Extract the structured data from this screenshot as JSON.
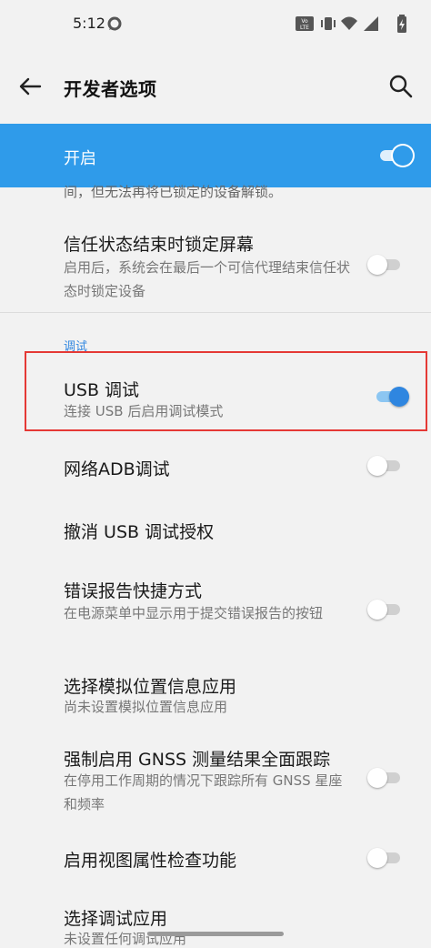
{
  "status_bar": {
    "time": "5:12",
    "volte_badge": "Vo LTE",
    "icons": [
      "whatsapp-icon",
      "volte-icon",
      "vibrate-icon",
      "wifi-icon",
      "signal-icon",
      "battery-charging-icon"
    ]
  },
  "app_bar": {
    "title": "开发者选项",
    "back_icon": "back-arrow-icon",
    "search_icon": "search-icon"
  },
  "master_switch": {
    "label": "开启",
    "on": true,
    "accent_color": "#2f9bea"
  },
  "truncated_text": "间，但无法再将已锁定的设备解锁。",
  "items": [
    {
      "id": "trust-agent-lock",
      "title": "信任状态结束时锁定屏幕",
      "subtitle": "启用后，系统会在最后一个可信代理结束信任状态时锁定设备",
      "toggle": false
    }
  ],
  "section": {
    "header": "调试"
  },
  "debug_items": [
    {
      "id": "usb-debugging",
      "title": "USB 调试",
      "subtitle": "连接 USB 后启用调试模式",
      "toggle": true,
      "highlighted": true
    },
    {
      "id": "network-adb",
      "title": "网络ADB调试",
      "subtitle": "",
      "toggle": false
    },
    {
      "id": "revoke-usb-auth",
      "title": "撤消 USB 调试授权",
      "subtitle": "",
      "toggle": null
    },
    {
      "id": "bug-report-shortcut",
      "title": "错误报告快捷方式",
      "subtitle": "在电源菜单中显示用于提交错误报告的按钮",
      "toggle": false
    },
    {
      "id": "mock-location-app",
      "title": "选择模拟位置信息应用",
      "subtitle": "尚未设置模拟位置信息应用",
      "toggle": null
    },
    {
      "id": "gnss-full-tracking",
      "title": "强制启用 GNSS 测量结果全面跟踪",
      "subtitle": "在停用工作周期的情况下跟踪所有 GNSS 星座和频率",
      "toggle": false
    },
    {
      "id": "view-attribute-inspection",
      "title": "启用视图属性检查功能",
      "subtitle": "",
      "toggle": false
    },
    {
      "id": "select-debug-app",
      "title": "选择调试应用",
      "subtitle": "未设置任何调试应用",
      "toggle": null
    }
  ],
  "colors": {
    "highlight_border": "#e53935",
    "toggle_on": "#2f86e0",
    "toggle_off_track": "#d0d0d0"
  }
}
